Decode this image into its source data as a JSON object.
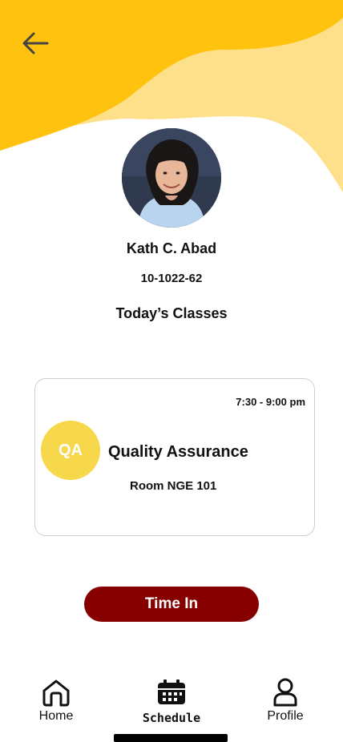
{
  "colors": {
    "header_primary": "#ffc20e",
    "header_secondary": "#ffe08a",
    "badge": "#f7d84a",
    "button": "#870000"
  },
  "header": {
    "back_icon": "arrow-left-icon"
  },
  "user": {
    "name": "Kath C. Abad",
    "id": "10-1022-62"
  },
  "section_title": "Today’s Classes",
  "class_card": {
    "time": "7:30 - 9:00 pm",
    "badge": "QA",
    "title": "Quality Assurance",
    "room": "Room NGE 101"
  },
  "time_in_label": "Time In",
  "nav": {
    "items": [
      {
        "label": "Home",
        "icon": "home-icon"
      },
      {
        "label": "Schedule",
        "icon": "calendar-icon",
        "active": true
      },
      {
        "label": "Profile",
        "icon": "user-icon"
      }
    ]
  }
}
